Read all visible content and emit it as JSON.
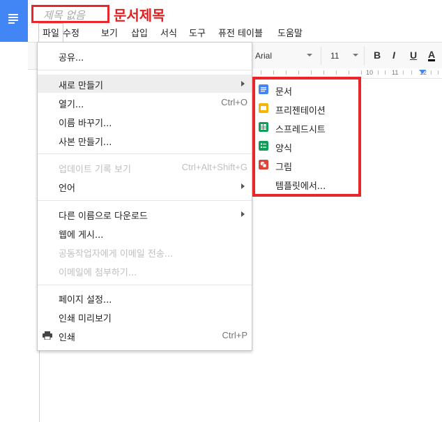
{
  "app": {
    "title": "제목 없음",
    "title_annotation": "문서제목"
  },
  "menubar": [
    "파일",
    "수정",
    "보기",
    "삽입",
    "서식",
    "도구",
    "퓨전 테이블",
    "도움말"
  ],
  "toolbar": {
    "font": "Arial",
    "size": "11",
    "bold": "B",
    "italic": "I",
    "underline": "U",
    "text_color": "A"
  },
  "ruler": [
    "10",
    "11",
    "12"
  ],
  "file_menu": {
    "share": "공유...",
    "new": "새로 만들기",
    "open": "열기...",
    "open_shortcut": "Ctrl+O",
    "rename": "이름 바꾸기...",
    "copy": "사본 만들기...",
    "revision_history": "업데이트 기록 보기",
    "revision_shortcut": "Ctrl+Alt+Shift+G",
    "language": "언어",
    "download_as": "다른 이름으로 다운로드",
    "publish": "웹에 게시...",
    "email_collaborators": "공동작업자에게 이메일 전송...",
    "email_attachment": "이메일에 첨부하기...",
    "page_setup": "페이지 설정...",
    "print_preview": "인쇄 미리보기",
    "print": "인쇄",
    "print_shortcut": "Ctrl+P"
  },
  "new_submenu": {
    "items": [
      "문서",
      "프리젠테이션",
      "스프레드시트",
      "양식",
      "그림",
      "템플릿에서..."
    ],
    "colors": [
      "#4285f4",
      "#f4b400",
      "#0f9d58",
      "#0f9d58",
      "#db4437"
    ]
  },
  "colors": {
    "annotation_red": "#e8262c",
    "brand_blue": "#4285f4"
  }
}
